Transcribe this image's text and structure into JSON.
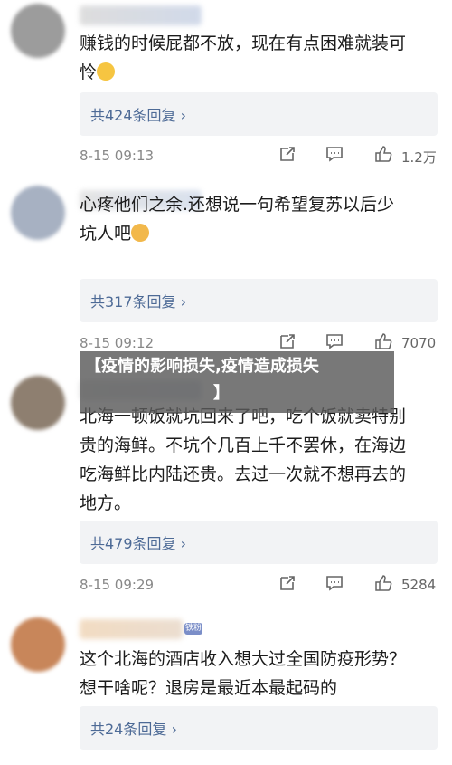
{
  "comments": [
    {
      "text_line1": "赚钱的时候屁都不放，现在有点困难就装可",
      "text_line2": "怜",
      "emoji": "crying-face-emoji",
      "reply_label": "共424条回复 ›",
      "time": "8-15 09:13",
      "likes": "1.2万"
    },
    {
      "text_line1": "心疼他们之余.还想说一句希望复苏以后少",
      "text_line2": "坑人吧",
      "emoji": "cat-face-emoji",
      "reply_label": "共317条回复 ›",
      "time": "8-15 09:12",
      "likes": "7070"
    },
    {
      "text_line1": "北海一顿饭就坑回来了吧，吃个饭就卖特别",
      "text_line2": "贵的海鲜。不坑个几百上千不罢休，在海边",
      "text_line3": "吃海鲜比内陆还贵。去过一次就不想再去的",
      "text_line4": "地方。",
      "reply_label": "共479条回复 ›",
      "time": "8-15 09:29",
      "likes": "5284"
    },
    {
      "text_line1": "这个北海的酒店收入想大过全国防疫形势？",
      "text_line2": "想干啥呢？退房是最近本最起码的",
      "badge": "铁粉",
      "reply_label": "共24条回复 ›"
    }
  ],
  "overlay": {
    "title": "【疫情的影响损失,疫情造成损失",
    "title_end": "】"
  },
  "colors": {
    "reply_link": "#4d6a96",
    "reply_bg": "#f2f3f5",
    "overlay_bg": "#5a5a5a"
  }
}
